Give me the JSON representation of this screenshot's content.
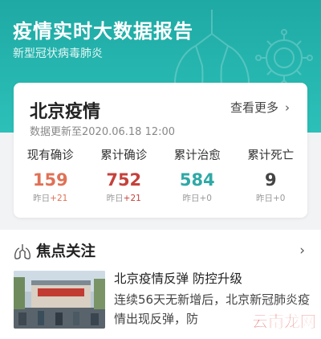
{
  "header": {
    "title": "疫情实时大数据报告",
    "subtitle": "新型冠状病毒肺炎"
  },
  "region_card": {
    "title": "北京疫情",
    "more_label": "查看更多",
    "update_time": "数据更新至2020.06.18 12:00",
    "stats": [
      {
        "label": "现有确诊",
        "value": "159",
        "delta_prefix": "昨日",
        "delta": "+21",
        "color": "#e07156"
      },
      {
        "label": "累计确诊",
        "value": "752",
        "delta_prefix": "昨日",
        "delta": "+21",
        "color": "#c5413b"
      },
      {
        "label": "累计治愈",
        "value": "584",
        "delta_prefix": "昨日",
        "delta": "+0",
        "color": "#2fa9a6"
      },
      {
        "label": "累计死亡",
        "value": "9",
        "delta_prefix": "昨日",
        "delta": "+0",
        "color": "#444444"
      }
    ]
  },
  "focus": {
    "title": "焦点关注",
    "news": [
      {
        "title": "北京疫情反弹 防控升级",
        "summary": "连续56天无新增后，北京新冠肺炎疫情出现反弹，防"
      }
    ]
  },
  "watermark": "云南龙网",
  "colors": {
    "brand_teal": "#26b3ad",
    "accent_red": "#c5413b"
  },
  "icons": {
    "focus": "lungs-icon",
    "more": "chevron-right-icon"
  }
}
